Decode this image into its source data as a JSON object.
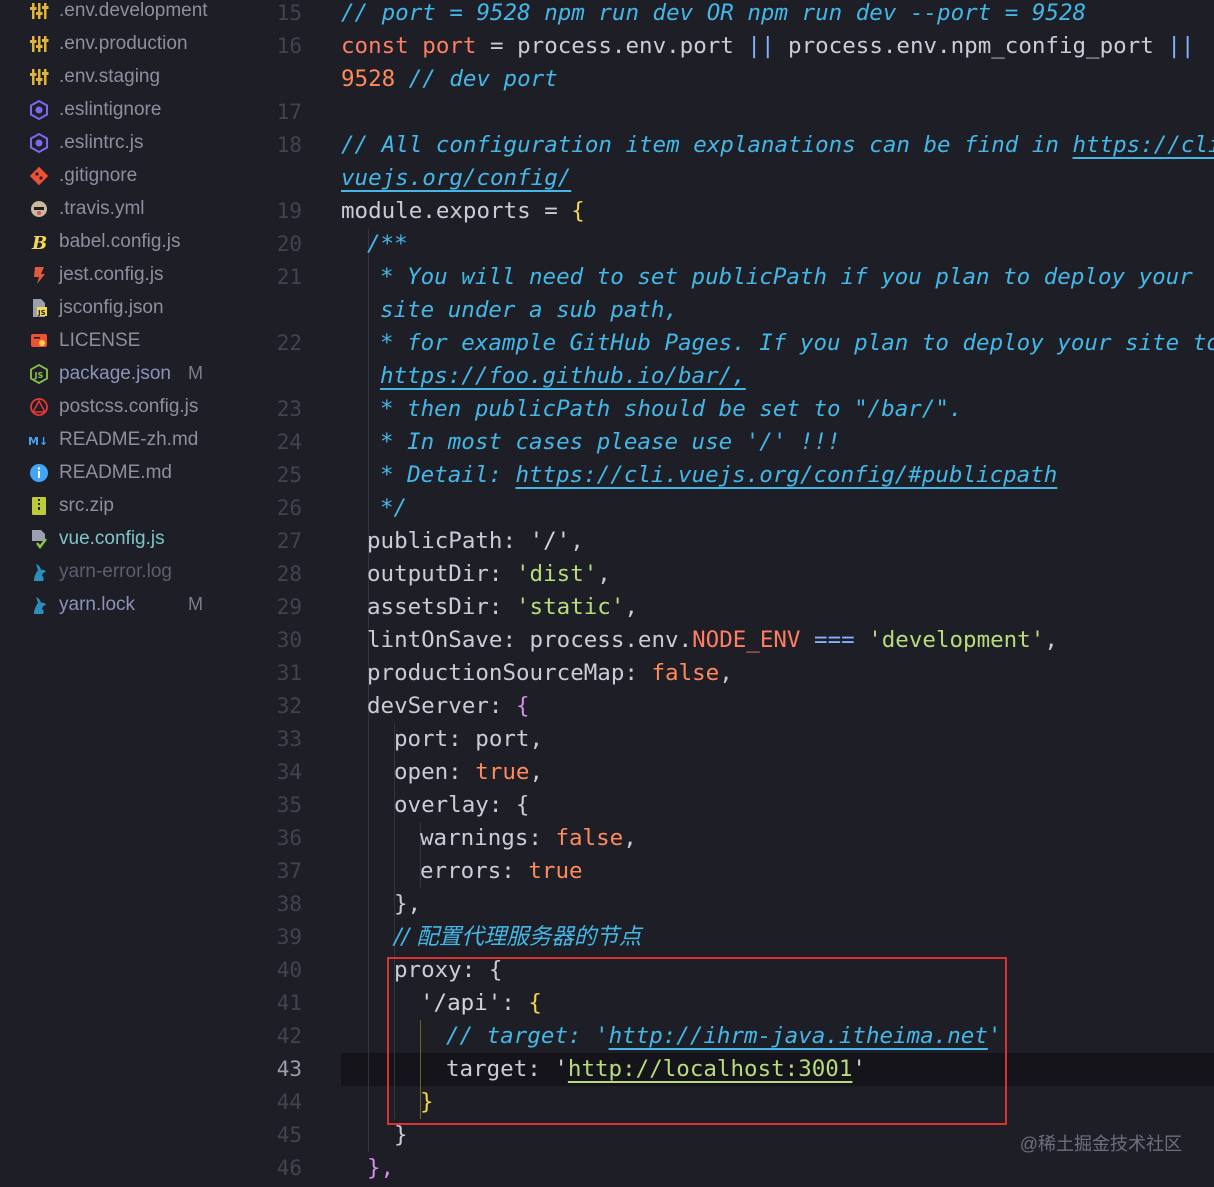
{
  "explorer": {
    "files": [
      {
        "name": ".env.development",
        "icon": "env-settings-icon",
        "color": "#e0b43b"
      },
      {
        "name": ".env.production",
        "icon": "env-settings-icon",
        "color": "#e0b43b"
      },
      {
        "name": ".env.staging",
        "icon": "env-settings-icon",
        "color": "#e0b43b"
      },
      {
        "name": ".eslintignore",
        "icon": "eslint-icon",
        "color": "#7b68ee"
      },
      {
        "name": ".eslintrc.js",
        "icon": "eslint-icon",
        "color": "#7b68ee"
      },
      {
        "name": ".gitignore",
        "icon": "git-icon",
        "color": "#f05133"
      },
      {
        "name": ".travis.yml",
        "icon": "travis-icon",
        "color": "#c9b89a"
      },
      {
        "name": "babel.config.js",
        "icon": "babel-icon",
        "color": "#f5da55"
      },
      {
        "name": "jest.config.js",
        "icon": "jest-icon",
        "color": "#e25b3e"
      },
      {
        "name": "jsconfig.json",
        "icon": "jsconfig-icon",
        "color": "#f5da55"
      },
      {
        "name": "LICENSE",
        "icon": "license-icon",
        "color": "#f05133"
      },
      {
        "name": "package.json",
        "icon": "npm-icon",
        "color": "#8bc34a",
        "badge": "M"
      },
      {
        "name": "postcss.config.js",
        "icon": "postcss-icon",
        "color": "#e53935"
      },
      {
        "name": "README-zh.md",
        "icon": "markdown-icon",
        "color": "#42a5f5"
      },
      {
        "name": "README.md",
        "icon": "info-icon",
        "color": "#42a5f5"
      },
      {
        "name": "src.zip",
        "icon": "zip-icon",
        "color": "#c0ca33"
      },
      {
        "name": "vue.config.js",
        "icon": "vue-config-icon",
        "color": "#8bc34a"
      },
      {
        "name": "yarn-error.log",
        "icon": "yarn-icon",
        "color": "#2c8ebb"
      },
      {
        "name": "yarn.lock",
        "icon": "yarn-icon",
        "color": "#2c8ebb",
        "badge": "M"
      }
    ]
  },
  "gutter": {
    "line_numbers": [
      "15",
      "16",
      "17",
      "18",
      "19",
      "20",
      "21",
      "22",
      "23",
      "24",
      "25",
      "26",
      "27",
      "28",
      "29",
      "30",
      "31",
      "32",
      "33",
      "34",
      "35",
      "36",
      "37",
      "38",
      "39",
      "40",
      "41",
      "42",
      "43",
      "44",
      "45",
      "46"
    ],
    "current_line": "43"
  },
  "code": {
    "l01": "// port = 9528 npm run dev OR npm run dev --port = 9528",
    "l02_const": "const",
    "l02_port": "port",
    "l02_rest": " = process.env.port ",
    "l02_or1": "||",
    "l02_rest2": " process.env.npm_config_port ",
    "l02_or2": "||",
    "l03_num": "9528",
    "l03_cm": " // dev port",
    "l05_a": "// All configuration item explanations can be find in ",
    "l05_link": "https://cli.",
    "l06_link": "vuejs.org/config/",
    "l07": "module.exports = ",
    "l07_brace": "{",
    "l08": "/**",
    "l09": "* You will need to set publicPath if you plan to deploy your",
    "l10": "site under a sub path,",
    "l11": "* for example GitHub Pages. If you plan to deploy your site to",
    "l12": "https://foo.github.io/bar/,",
    "l13": "* then publicPath should be set to \"/bar/\".",
    "l14": "* In most cases please use '/' !!!",
    "l15_a": "* Detail: ",
    "l15_link": "https://cli.vuejs.org/config/#publicpath",
    "l16": "*/",
    "l17_k": "publicPath: ",
    "l17_v": "'/'",
    "l18_k": "outputDir: ",
    "l18_v": "'dist'",
    "l19_k": "assetsDir: ",
    "l19_v": "'static'",
    "l20_k": "lintOnSave: process.env.",
    "l20_env": "NODE_ENV",
    "l20_op": "===",
    "l20_v": "'development'",
    "l21_k": "productionSourceMap: ",
    "l21_v": "false",
    "l22_k": "devServer: ",
    "l22_brace": "{",
    "l23": "port: port,",
    "l24_k": "open: ",
    "l24_v": "true",
    "l25_k": "overlay: ",
    "l25_brace": "{",
    "l26_k": "warnings: ",
    "l26_v": "false",
    "l27_k": "errors: ",
    "l27_v": "true",
    "l28": "},",
    "l29": "// 配置代理服务器的节点",
    "l30_k": "proxy: ",
    "l30_brace": "{",
    "l31_k": "'/api'",
    "l31_brace": "{",
    "l32_a": "// target: '",
    "l32_link": "http://ihrm-java.itheima.net",
    "l32_b": "'",
    "l33_k": "target: ",
    "l33_q1": "'",
    "l33_link": "http://localhost:3001",
    "l33_q2": "'",
    "l34": "}",
    "l35": "}",
    "l36": "},"
  },
  "watermark": "@稀土掘金技术社区",
  "colors": {
    "background": "#1e1e27",
    "comment": "#44b7e6",
    "keyword": "#ff7e62",
    "string": "#b7dc7b",
    "highlight_box": "#d8342f"
  }
}
